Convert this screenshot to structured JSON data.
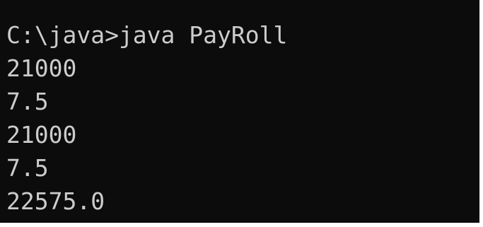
{
  "terminal": {
    "lines": [
      "C:\\java>java PayRoll",
      "21000",
      "7.5",
      "21000",
      "7.5",
      "22575.0"
    ],
    "colors": {
      "background": "#0c0c0c",
      "text": "#cccccc"
    }
  }
}
